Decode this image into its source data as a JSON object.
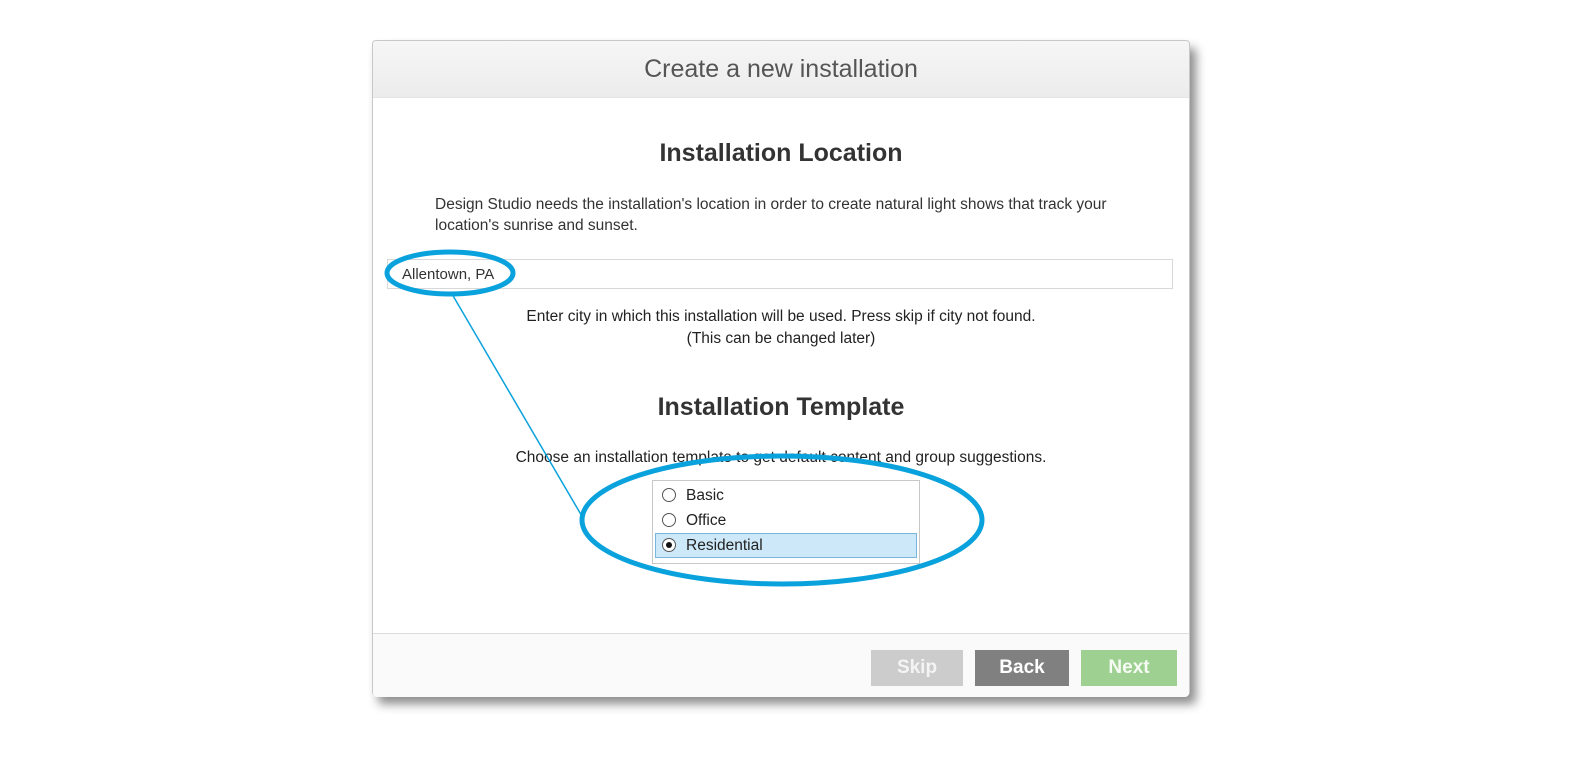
{
  "dialog": {
    "title": "Create a new installation"
  },
  "location": {
    "heading": "Installation Location",
    "description": "Design Studio needs the installation's location in order to create natural light shows that track your location's sunrise and sunset.",
    "input_value": "Allentown, PA",
    "hint_line1": "Enter city in which this installation will be used. Press skip if city not found.",
    "hint_line2": "(This can be changed later)"
  },
  "template": {
    "heading": "Installation Template",
    "description": "Choose an installation template to get default content and group suggestions.",
    "options": [
      {
        "label": "Basic",
        "selected": false
      },
      {
        "label": "Office",
        "selected": false
      },
      {
        "label": "Residential",
        "selected": true
      }
    ]
  },
  "footer": {
    "skip_label": "Skip",
    "back_label": "Back",
    "next_label": "Next"
  },
  "colors": {
    "annotation": "#0aa2dc",
    "selection": "#cde8f8",
    "next_button": "#9ed091",
    "back_button": "#808080",
    "skip_button": "#cccccc"
  }
}
